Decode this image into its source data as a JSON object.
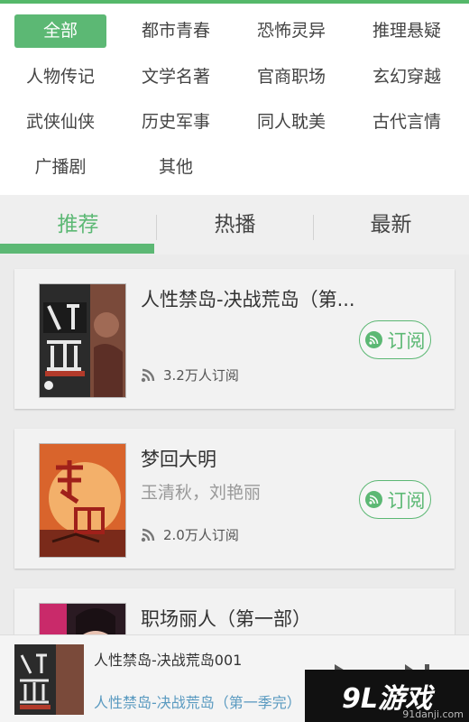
{
  "accent_color": "#5cb874",
  "categories": {
    "row1": [
      "全部",
      "都市青春",
      "恐怖灵异",
      "推理悬疑"
    ],
    "row2": [
      "人物传记",
      "文学名著",
      "官商职场",
      "玄幻穿越"
    ],
    "row3": [
      "武侠仙侠",
      "历史军事",
      "同人耽美",
      "古代言情"
    ],
    "row4": [
      "广播剧",
      "其他"
    ],
    "selected": "全部"
  },
  "tabs": [
    "推荐",
    "热播",
    "最新"
  ],
  "active_tab": "推荐",
  "subscribe_label": "订阅",
  "cards": [
    {
      "title": "人性禁岛-决战荒岛（第...",
      "author": "",
      "subscribers": "3.2万人订阅",
      "cover_icon": "book-cover-renxing-jindao"
    },
    {
      "title": "梦回大明",
      "author": "玉清秋，刘艳丽",
      "subscribers": "2.0万人订阅",
      "cover_icon": "book-cover-menghui-daming"
    },
    {
      "title": "职场丽人（第一部）",
      "author": "",
      "subscribers": "",
      "cover_icon": "book-cover-zhichang-liren"
    }
  ],
  "player": {
    "track_title": "人性禁岛-决战荒岛001",
    "album_title": "人性禁岛-决战荒岛（第一季完）"
  },
  "watermark": {
    "logo": "9L游戏",
    "url": "91danji.com"
  }
}
